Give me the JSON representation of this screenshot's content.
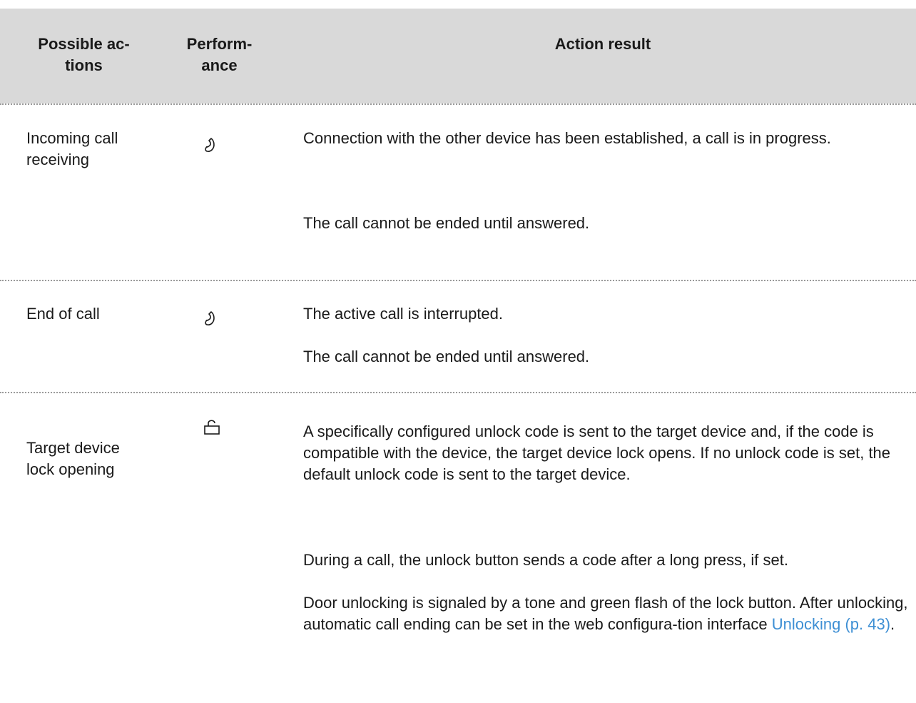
{
  "header": {
    "col1": "Possible ac-\ntions",
    "col2": "Perform-\nance",
    "col3": "Action result"
  },
  "rows": [
    {
      "action": "Incoming call\nreceiving",
      "icon": "handset-icon",
      "results": [
        "Connection with the other device has been established, a call is in progress.",
        "The call cannot be ended until answered."
      ]
    },
    {
      "action": "End of call",
      "icon": "handset-icon",
      "results": [
        "The active call is interrupted.",
        "The call cannot be ended until answered."
      ]
    },
    {
      "action": "Target device\nlock opening",
      "icon": "lock-icon",
      "results": [
        "A specifically configured unlock code is sent to the target device and, if the code is compatible with the device, the target device lock opens. If no unlock code is set, the default unlock code is sent to the target device.",
        "During a call, the unlock button sends a code after a long press, if set."
      ],
      "result3_text": "Door unlocking is signaled by a tone and green flash of the lock button. After unlocking, automatic call ending can be set in the web configura-tion interface ",
      "result3_link": "Unlocking (p. 43)",
      "result3_end": "."
    }
  ],
  "colors": {
    "header_bg": "#d9d9d9",
    "link": "#3e8fd4",
    "separator": "#9a9a9a"
  }
}
